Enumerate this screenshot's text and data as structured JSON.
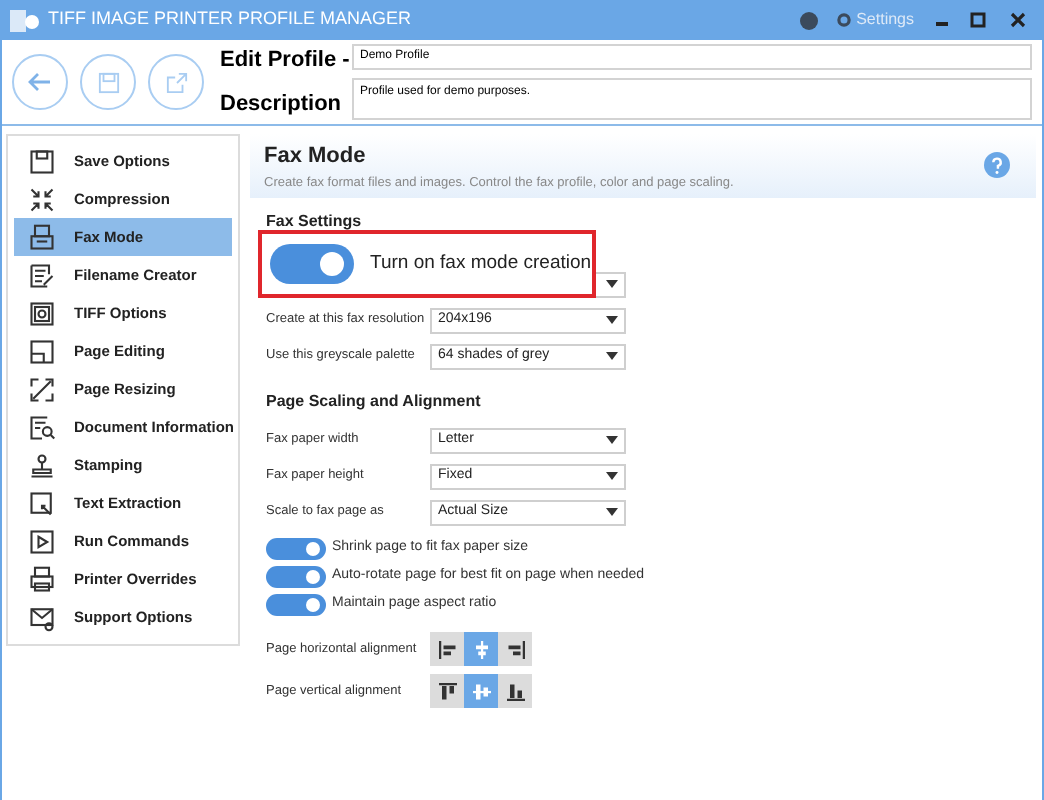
{
  "window": {
    "title": "TIFF IMAGE PRINTER PROFILE MANAGER",
    "settings_label": "Settings"
  },
  "header": {
    "profile_label": "Edit Profile -",
    "profile_value": "Demo Profile",
    "description_label": "Description",
    "description_value": "Profile used for demo purposes."
  },
  "sidebar": {
    "items": [
      {
        "label": "Save Options",
        "kind": "save",
        "selected": false
      },
      {
        "label": "Compression",
        "kind": "compress",
        "selected": false
      },
      {
        "label": "Fax Mode",
        "kind": "fax",
        "selected": true
      },
      {
        "label": "Filename Creator",
        "kind": "filename",
        "selected": false
      },
      {
        "label": "TIFF Options",
        "kind": "tiff",
        "selected": false
      },
      {
        "label": "Page Editing",
        "kind": "pageedit",
        "selected": false
      },
      {
        "label": "Page Resizing",
        "kind": "resize",
        "selected": false
      },
      {
        "label": "Document Information",
        "kind": "docinfo",
        "selected": false
      },
      {
        "label": "Stamping",
        "kind": "stamp",
        "selected": false
      },
      {
        "label": "Text Extraction",
        "kind": "textext",
        "selected": false
      },
      {
        "label": "Run Commands",
        "kind": "run",
        "selected": false
      },
      {
        "label": "Printer Overrides",
        "kind": "printer",
        "selected": false
      },
      {
        "label": "Support Options",
        "kind": "support",
        "selected": false
      }
    ]
  },
  "panel": {
    "title": "Fax Mode",
    "subtitle": "Create fax format files and images. Control the fax profile, color and page scaling.",
    "fax_settings": {
      "heading": "Fax Settings",
      "callout": {
        "label": "Turn on fax mode creation",
        "on": true
      },
      "fields": [
        {
          "label": "Create at this fax resolution",
          "value": "204x196"
        },
        {
          "label": "Use this greyscale palette",
          "value": "64 shades of grey"
        }
      ]
    },
    "scaling": {
      "heading": "Page Scaling and Alignment",
      "fields": [
        {
          "label": "Fax paper width",
          "value": "Letter"
        },
        {
          "label": "Fax paper height",
          "value": "Fixed"
        },
        {
          "label": "Scale to fax page as",
          "value": "Actual Size"
        }
      ],
      "toggles": [
        {
          "label": "Shrink page to fit fax paper size",
          "on": true
        },
        {
          "label": "Auto-rotate page for best fit on page when needed",
          "on": true
        },
        {
          "label": "Maintain page aspect ratio",
          "on": true
        }
      ],
      "alignments": [
        {
          "label": "Page horizontal alignment",
          "options": [
            {
              "kind": "left",
              "selected": false
            },
            {
              "kind": "hcenter",
              "selected": true
            },
            {
              "kind": "right",
              "selected": false
            }
          ]
        },
        {
          "label": "Page vertical alignment",
          "options": [
            {
              "kind": "top",
              "selected": false
            },
            {
              "kind": "vcenter",
              "selected": true
            },
            {
              "kind": "bottom",
              "selected": false
            }
          ]
        }
      ]
    }
  }
}
